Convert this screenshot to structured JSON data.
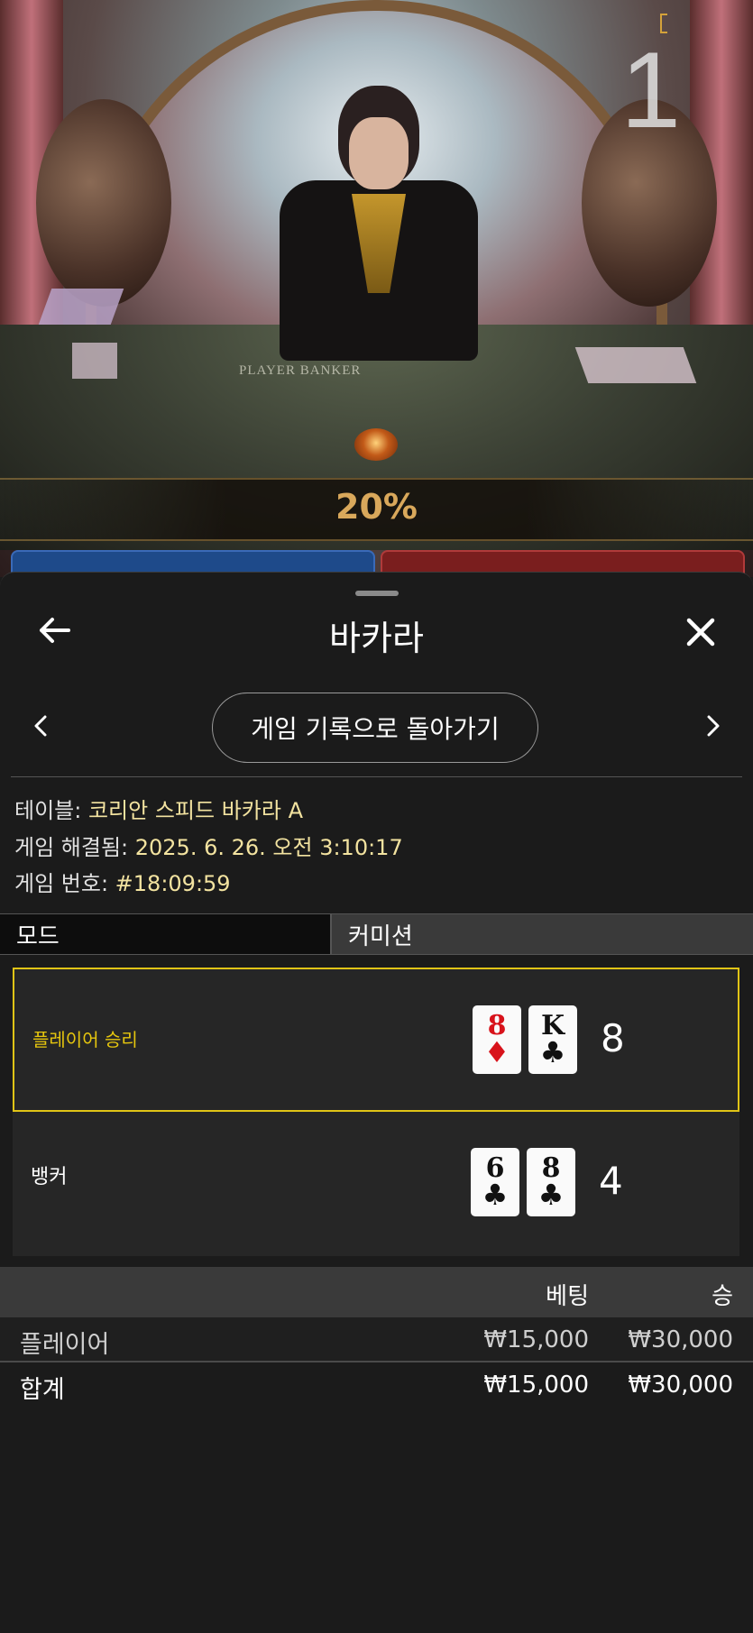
{
  "stream": {
    "percent": "20%",
    "round_number": "1",
    "table_text": "PLAYER   BANKER"
  },
  "panel": {
    "title": "바카라",
    "back_icon": "arrow-left-icon",
    "close_icon": "close-icon",
    "history_button": "게임 기록으로 돌아가기",
    "info": {
      "table_label": "테이블: ",
      "table_value": "코리안 스피드 바카라 A",
      "resolved_label": "게임 해결됨: ",
      "resolved_value": "2025. 6. 26. 오전 3:10:17",
      "game_no_label": "게임 번호: ",
      "game_no_value": "#18:09:59"
    },
    "tabs": {
      "mode": "모드",
      "commission": "커미션"
    },
    "results": {
      "player": {
        "label": "플레이어 승리",
        "cards": [
          {
            "rank": "8",
            "suit": "♦",
            "color": "red"
          },
          {
            "rank": "K",
            "suit": "♣",
            "color": "black"
          }
        ],
        "score": "8"
      },
      "banker": {
        "label": "뱅커",
        "cards": [
          {
            "rank": "6",
            "suit": "♣",
            "color": "black"
          },
          {
            "rank": "8",
            "suit": "♣",
            "color": "black"
          }
        ],
        "score": "4"
      }
    },
    "bets": {
      "header_bet": "베팅",
      "header_win": "승",
      "rows": [
        {
          "label": "플레이어",
          "bet": "₩15,000",
          "win": "₩30,000"
        }
      ],
      "total": {
        "label": "합계",
        "bet": "₩15,000",
        "win": "₩30,000"
      }
    }
  },
  "colors": {
    "winner_border": "#e0c416",
    "percent": "#d9a85b",
    "panel_bg": "#1b1b1b"
  }
}
